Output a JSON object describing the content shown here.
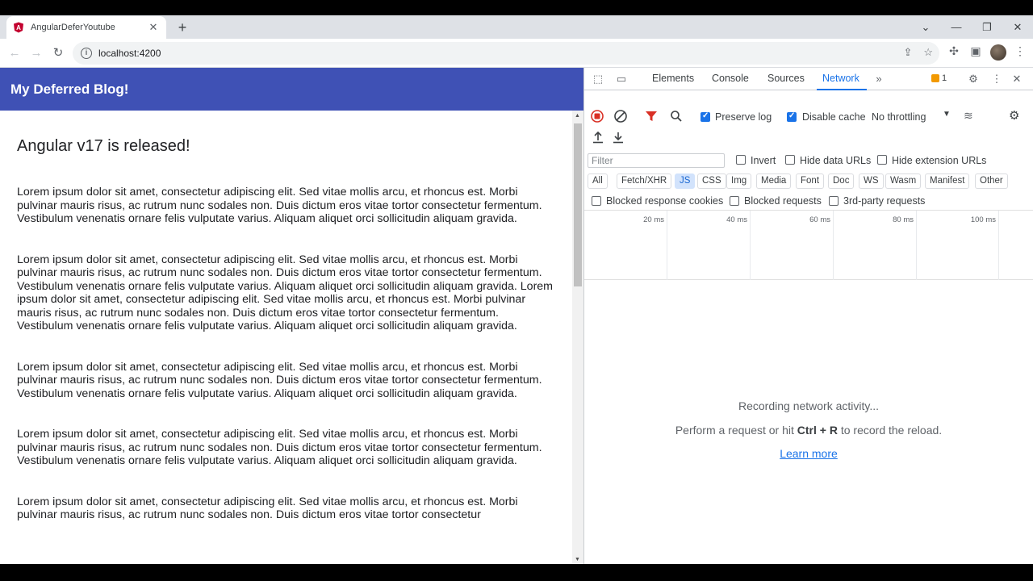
{
  "browser": {
    "tab_title": "AngularDeferYoutube",
    "url": "localhost:4200"
  },
  "page": {
    "app_title": "My Deferred Blog!",
    "post_title": "Angular v17 is released!",
    "paragraphs": [
      "Lorem ipsum dolor sit amet, consectetur adipiscing elit. Sed vitae mollis arcu, et rhoncus est. Morbi pulvinar mauris risus, ac rutrum nunc sodales non. Duis dictum eros vitae tortor consectetur fermentum. Vestibulum venenatis ornare felis vulputate varius. Aliquam aliquet orci sollicitudin aliquam gravida.",
      "Lorem ipsum dolor sit amet, consectetur adipiscing elit. Sed vitae mollis arcu, et rhoncus est. Morbi pulvinar mauris risus, ac rutrum nunc sodales non. Duis dictum eros vitae tortor consectetur fermentum. Vestibulum venenatis ornare felis vulputate varius. Aliquam aliquet orci sollicitudin aliquam gravida. Lorem ipsum dolor sit amet, consectetur adipiscing elit. Sed vitae mollis arcu, et rhoncus est. Morbi pulvinar mauris risus, ac rutrum nunc sodales non. Duis dictum eros vitae tortor consectetur fermentum. Vestibulum venenatis ornare felis vulputate varius. Aliquam aliquet orci sollicitudin aliquam gravida.",
      "Lorem ipsum dolor sit amet, consectetur adipiscing elit. Sed vitae mollis arcu, et rhoncus est. Morbi pulvinar mauris risus, ac rutrum nunc sodales non. Duis dictum eros vitae tortor consectetur fermentum. Vestibulum venenatis ornare felis vulputate varius. Aliquam aliquet orci sollicitudin aliquam gravida.",
      "Lorem ipsum dolor sit amet, consectetur adipiscing elit. Sed vitae mollis arcu, et rhoncus est. Morbi pulvinar mauris risus, ac rutrum nunc sodales non. Duis dictum eros vitae tortor consectetur fermentum. Vestibulum venenatis ornare felis vulputate varius. Aliquam aliquet orci sollicitudin aliquam gravida.",
      "Lorem ipsum dolor sit amet, consectetur adipiscing elit. Sed vitae mollis arcu, et rhoncus est. Morbi pulvinar mauris risus, ac rutrum nunc sodales non. Duis dictum eros vitae tortor consectetur"
    ],
    "accent_color": "#3f51b5"
  },
  "devtools": {
    "tabs": [
      "Elements",
      "Console",
      "Sources",
      "Network"
    ],
    "active_tab": "Network",
    "issues_count": "1",
    "toolbar": {
      "preserve_log": "Preserve log",
      "disable_cache": "Disable cache",
      "throttling": "No throttling"
    },
    "filter": {
      "placeholder": "Filter",
      "invert": "Invert",
      "hide_data_urls": "Hide data URLs",
      "hide_extension_urls": "Hide extension URLs"
    },
    "type_filters": [
      "All",
      "Fetch/XHR",
      "JS",
      "CSS",
      "Img",
      "Media",
      "Font",
      "Doc",
      "WS",
      "Wasm",
      "Manifest",
      "Other"
    ],
    "active_type_filter": "JS",
    "checkboxes": {
      "blocked_response_cookies": "Blocked response cookies",
      "blocked_requests": "Blocked requests",
      "third_party": "3rd-party requests"
    },
    "timeline_ticks": [
      "20 ms",
      "40 ms",
      "60 ms",
      "80 ms",
      "100 ms"
    ],
    "empty": {
      "recording": "Recording network activity...",
      "hint_prefix": "Perform a request or hit",
      "hint_keys": "Ctrl + R",
      "hint_suffix": "to record the reload.",
      "learn_more": "Learn more"
    }
  }
}
